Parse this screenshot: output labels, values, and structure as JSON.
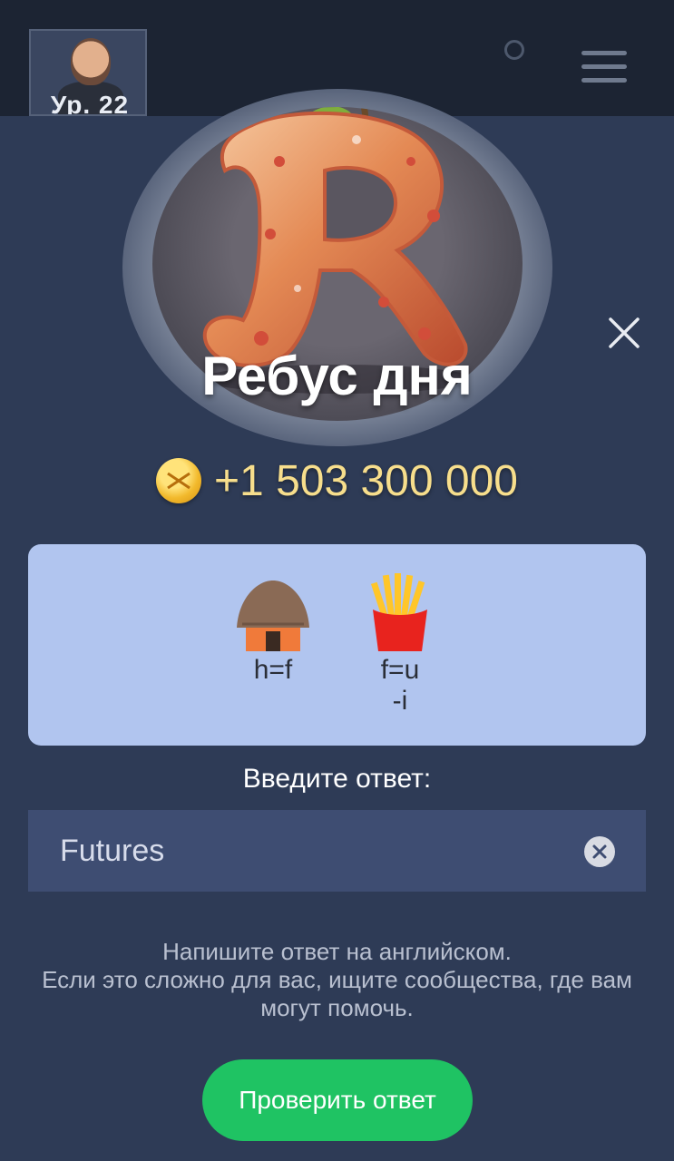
{
  "topbar": {
    "level_label": "Ур. 22",
    "icons": [
      "avatar",
      "menu-icon"
    ]
  },
  "modal": {
    "title": "Ребус дня",
    "reward": {
      "amount": "+1 503 300 000",
      "icon": "coin-icon"
    },
    "puzzle": {
      "clues": [
        {
          "emoji": "hut",
          "label_line1": "h=f",
          "label_line2": ""
        },
        {
          "emoji": "fries",
          "label_line1": "f=u",
          "label_line2": "-i"
        }
      ]
    },
    "answer_label": "Введите ответ:",
    "answer_value": "Futures",
    "hint_lines": [
      "Напишите ответ на английском.",
      "Если это сложно для вас, ищите сообщества, где вам",
      "могут помочь."
    ],
    "check_button_label": "Проверить ответ"
  },
  "colors": {
    "background": "#2e3b56",
    "puzzle_card": "#b1c5ef",
    "button": "#1fc363",
    "reward_text": "#f7de8c"
  }
}
